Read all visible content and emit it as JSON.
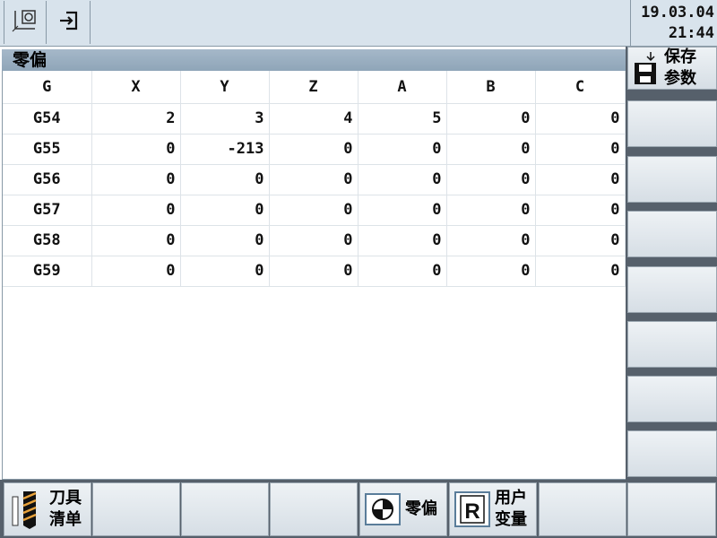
{
  "topbar": {
    "btn1_icon": "machine-coordinate-icon",
    "btn2_icon": "exit-icon",
    "date": "19.03.04",
    "time": "21:44"
  },
  "title": "零偏",
  "table": {
    "headers": [
      "G",
      "X",
      "Y",
      "Z",
      "A",
      "B",
      "C"
    ],
    "rows": [
      [
        "G54",
        "2",
        "3",
        "4",
        "5",
        "0",
        "0"
      ],
      [
        "G55",
        "0",
        "-213",
        "0",
        "0",
        "0",
        "0"
      ],
      [
        "G56",
        "0",
        "0",
        "0",
        "0",
        "0",
        "0"
      ],
      [
        "G57",
        "0",
        "0",
        "0",
        "0",
        "0",
        "0"
      ],
      [
        "G58",
        "0",
        "0",
        "0",
        "0",
        "0",
        "0"
      ],
      [
        "G59",
        "0",
        "0",
        "0",
        "0",
        "0",
        "0"
      ]
    ]
  },
  "right_softkeys": {
    "save": {
      "line1": "保存",
      "line2": "参数",
      "icon": "floppy-save-icon"
    }
  },
  "bottom_softkeys": {
    "tool_list": {
      "line1": "刀具",
      "line2": "清单",
      "icon": "drill-bit-icon"
    },
    "zero_offset": {
      "label": "零偏",
      "icon": "crosshair-target-icon"
    },
    "user_vars": {
      "line1": "用户",
      "line2": "变量",
      "icon": "r-variable-icon"
    }
  },
  "colors": {
    "panel_bg": "#d8e3ec",
    "title_bar": "#9aafc1",
    "softkey_track": "#56606b"
  }
}
